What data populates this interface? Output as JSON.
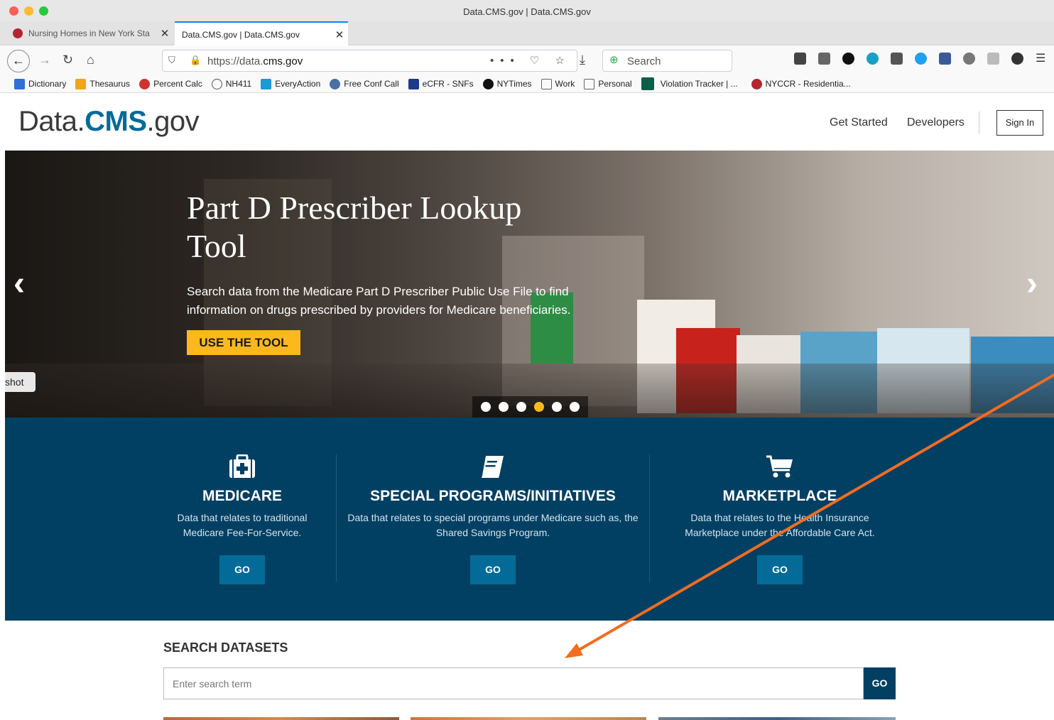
{
  "window": {
    "title": "Data.CMS.gov | Data.CMS.gov"
  },
  "tabs": [
    {
      "label": "Nursing Homes in New York Sta",
      "active": false
    },
    {
      "label": "Data.CMS.gov | Data.CMS.gov",
      "active": true
    }
  ],
  "urlbar": {
    "scheme": "https://data.",
    "domain": "cms.gov",
    "actions": "••• ♡ ☆"
  },
  "searchbar": {
    "placeholder": "Search"
  },
  "bookmarks": [
    {
      "label": "Dictionary",
      "color": "#2f6fd6"
    },
    {
      "label": "Thesaurus",
      "color": "#f2a516"
    },
    {
      "label": "Percent Calc",
      "color": "#d2322d"
    },
    {
      "label": "NH411",
      "color": "#555555"
    },
    {
      "label": "EveryAction",
      "color": "#1a9ad6"
    },
    {
      "label": "Free Conf Call",
      "color": "#4a6fa5"
    },
    {
      "label": "eCFR - SNFs",
      "color": "#1e3a8a"
    },
    {
      "label": "NYTimes",
      "color": "#111111"
    },
    {
      "label": "Work",
      "color": "#888888"
    },
    {
      "label": "Personal",
      "color": "#888888"
    },
    {
      "label": "Violation Tracker | ...",
      "color": "#0b5e4a"
    },
    {
      "label": "NYCCR - Residentia...",
      "color": "#b3262f"
    }
  ],
  "site": {
    "logo_prefix": "Data.",
    "logo_brand": "CMS",
    "logo_suffix": ".gov",
    "nav": {
      "get_started": "Get Started",
      "developers": "Developers",
      "sign_in": "Sign In"
    }
  },
  "hero": {
    "title": "Part D Prescriber Lookup Tool",
    "description": "Search data from the Medicare Part D Prescriber Public Use File to find information on drugs prescribed by providers for Medicare beneficiaries.",
    "button": "USE THE TOOL",
    "prev_arrow": "‹",
    "next_arrow": "›",
    "side_tab": "shot",
    "slide_count": 6,
    "active_slide": 4
  },
  "categories": [
    {
      "icon": "medkit-icon",
      "glyph": "⊞",
      "title": "MEDICARE",
      "description": "Data that relates to traditional Medicare Fee-For-Service.",
      "button": "GO"
    },
    {
      "icon": "book-icon",
      "glyph": "▤",
      "title": "SPECIAL PROGRAMS/INITIATIVES",
      "description": "Data that relates to special programs under Medicare such as, the Shared Savings Program.",
      "button": "GO"
    },
    {
      "icon": "cart-icon",
      "glyph": "🛒",
      "title": "MARKETPLACE",
      "description": "Data that relates to the Health Insurance Marketplace under the Affordable Care Act.",
      "button": "GO"
    }
  ],
  "search": {
    "heading": "SEARCH DATASETS",
    "placeholder": "Enter search term",
    "button": "GO"
  },
  "colors": {
    "brand": "#046b99",
    "accent": "#fdb81e",
    "band": "#024063",
    "annotation": "#f26c21"
  }
}
